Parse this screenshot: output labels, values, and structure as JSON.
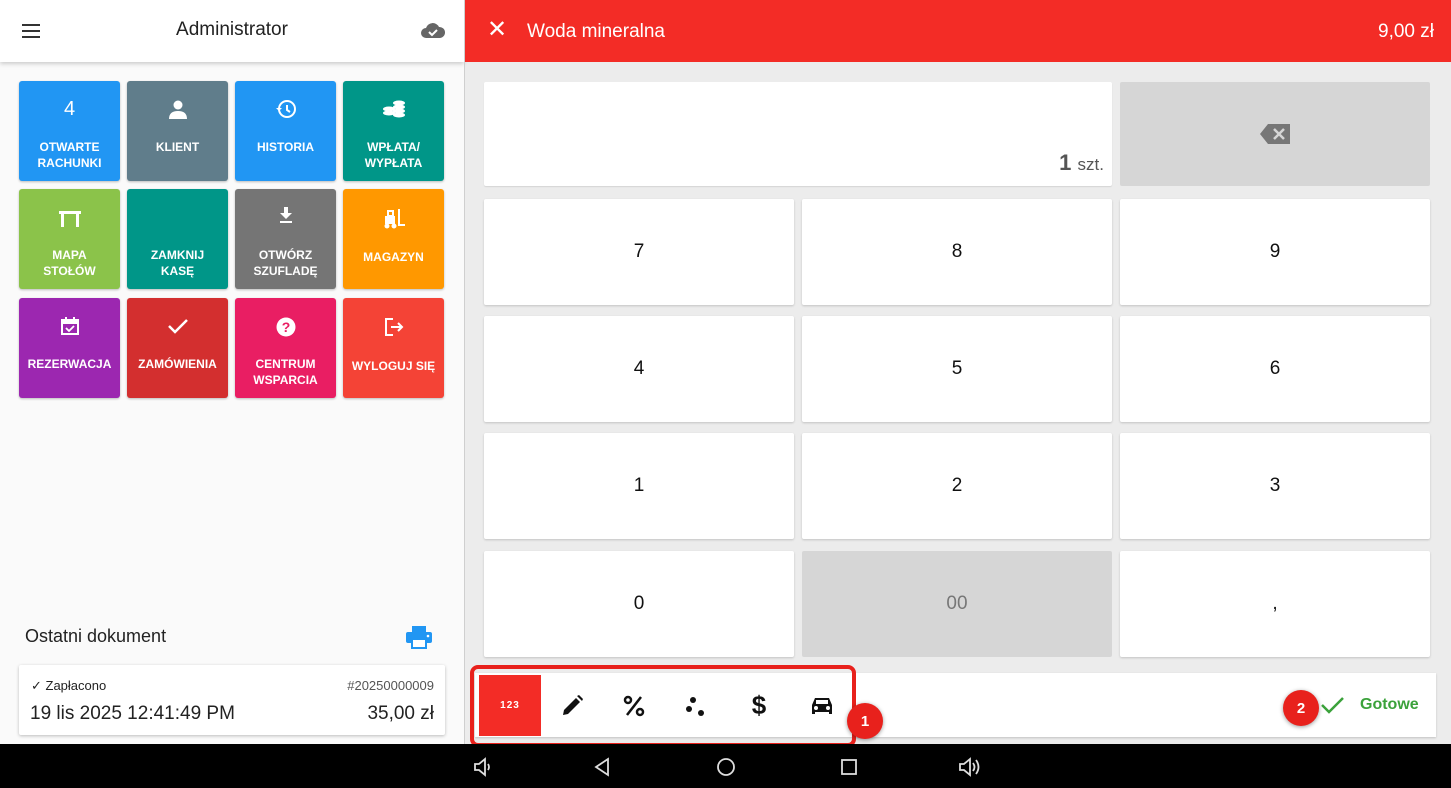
{
  "left_header": {
    "title": "Administrator",
    "menu_icon": "hamburger-icon",
    "cloud_icon": "cloud-check-icon"
  },
  "tiles": [
    {
      "icon_text": "4",
      "label_line1": "OTWARTE",
      "label_line2": "RACHUNKI",
      "color": "#2196f3"
    },
    {
      "icon_text": "",
      "label_line1": "KLIENT",
      "label_line2": "",
      "color": "#607d8b"
    },
    {
      "icon_text": "",
      "label_line1": "HISTORIA",
      "label_line2": "",
      "color": "#2196f3"
    },
    {
      "icon_text": "",
      "label_line1": "WPŁATA/",
      "label_line2": "WYPŁATA",
      "color": "#009688"
    },
    {
      "icon_text": "",
      "label_line1": "MAPA",
      "label_line2": "STOŁÓW",
      "color": "#8bc34a"
    },
    {
      "icon_text": "",
      "label_line1": "ZAMKNIJ",
      "label_line2": "KASĘ",
      "color": "#009688"
    },
    {
      "icon_text": "",
      "label_line1": "OTWÓRZ",
      "label_line2": "SZUFLADĘ",
      "color": "#757575"
    },
    {
      "icon_text": "",
      "label_line1": "MAGAZYN",
      "label_line2": "",
      "color": "#ff9800"
    },
    {
      "icon_text": "",
      "label_line1": "REZERWACJA",
      "label_line2": "",
      "color": "#9c27b0"
    },
    {
      "icon_text": "",
      "label_line1": "ZAMÓWIENIA",
      "label_line2": "",
      "color": "#d32f2f"
    },
    {
      "icon_text": "",
      "label_line1": "CENTRUM",
      "label_line2": "WSPARCIA",
      "color": "#e91e63"
    },
    {
      "icon_text": "",
      "label_line1": "WYLOGUJ SIĘ",
      "label_line2": "",
      "color": "#f44336"
    }
  ],
  "last_document": {
    "title": "Ostatni dokument",
    "status": "Zapłacono",
    "number": "#20250000009",
    "date": "19 lis 2025 12:41:49 PM",
    "amount": "35,00 zł"
  },
  "product": {
    "name": "Woda mineralna",
    "price": "9,00 zł"
  },
  "quantity": {
    "value": "1",
    "unit": "szt."
  },
  "keypad": [
    "7",
    "8",
    "9",
    "4",
    "5",
    "6",
    "1",
    "2",
    "3",
    "0",
    "00",
    ","
  ],
  "toolbar": {
    "tools": [
      "numbers",
      "edit",
      "discount",
      "modifiers",
      "price",
      "delivery"
    ],
    "active_label": "123",
    "done_label": "Gotowe"
  },
  "badges": {
    "first": "1",
    "second": "2"
  },
  "colors": {
    "accent": "#f32c26",
    "done_green": "#3ba23b"
  }
}
